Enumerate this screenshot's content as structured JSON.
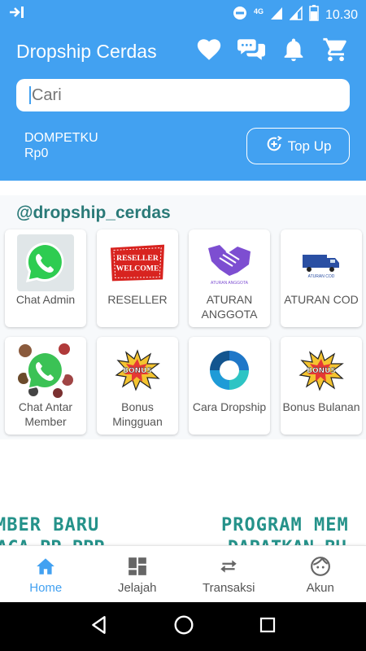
{
  "status_bar": {
    "time": "10.30",
    "network": "4G",
    "icons": [
      "cast-exit-icon",
      "do-not-disturb-icon",
      "signal-icon",
      "signal-icon",
      "battery-icon"
    ]
  },
  "header": {
    "title": "Dropship Cerdas",
    "icons": [
      "heart-icon",
      "chat-icon",
      "bell-icon",
      "cart-icon"
    ]
  },
  "search": {
    "placeholder": "Cari"
  },
  "wallet": {
    "label": "DOMPETKU",
    "balance": "Rp0",
    "topup_label": "Top Up"
  },
  "section": {
    "title": "@dropship_cerdas"
  },
  "menu": [
    {
      "label": "Chat Admin",
      "icon": "whatsapp-icon"
    },
    {
      "label": "RESELLER",
      "icon": "reseller-welcome-badge",
      "badge_text": "RESELLER WELCOME"
    },
    {
      "label": "ATURAN ANGGOTA",
      "icon": "handshake-icon",
      "caption": "ATURAN ANGGOTA"
    },
    {
      "label": "ATURAN COD",
      "icon": "truck-icon",
      "caption": "ATURAN COD"
    },
    {
      "label": "Chat Antar Member",
      "icon": "whatsapp-group-icon"
    },
    {
      "label": "Bonus Mingguan",
      "icon": "bonus-burst-icon",
      "badge_text": "BONUS"
    },
    {
      "label": "Cara Dropship",
      "icon": "dropship-logo-icon"
    },
    {
      "label": "Bonus Bulanan",
      "icon": "bonus-burst-icon",
      "badge_text": "BONUS"
    }
  ],
  "banner": {
    "left": "MBER BARU",
    "right": "PROGRAM MEM",
    "left_sub": "ACA  PP PPP",
    "right_sub": "DAPATKAN BU"
  },
  "bottom_nav": [
    {
      "label": "Home",
      "icon": "home-icon",
      "active": true
    },
    {
      "label": "Jelajah",
      "icon": "dashboard-icon",
      "active": false
    },
    {
      "label": "Transaksi",
      "icon": "swap-arrows-icon",
      "active": false
    },
    {
      "label": "Akun",
      "icon": "face-icon",
      "active": false
    }
  ],
  "colors": {
    "primary": "#42a1f1",
    "accent_teal": "#2a7a78",
    "banner_teal": "#25928a"
  }
}
